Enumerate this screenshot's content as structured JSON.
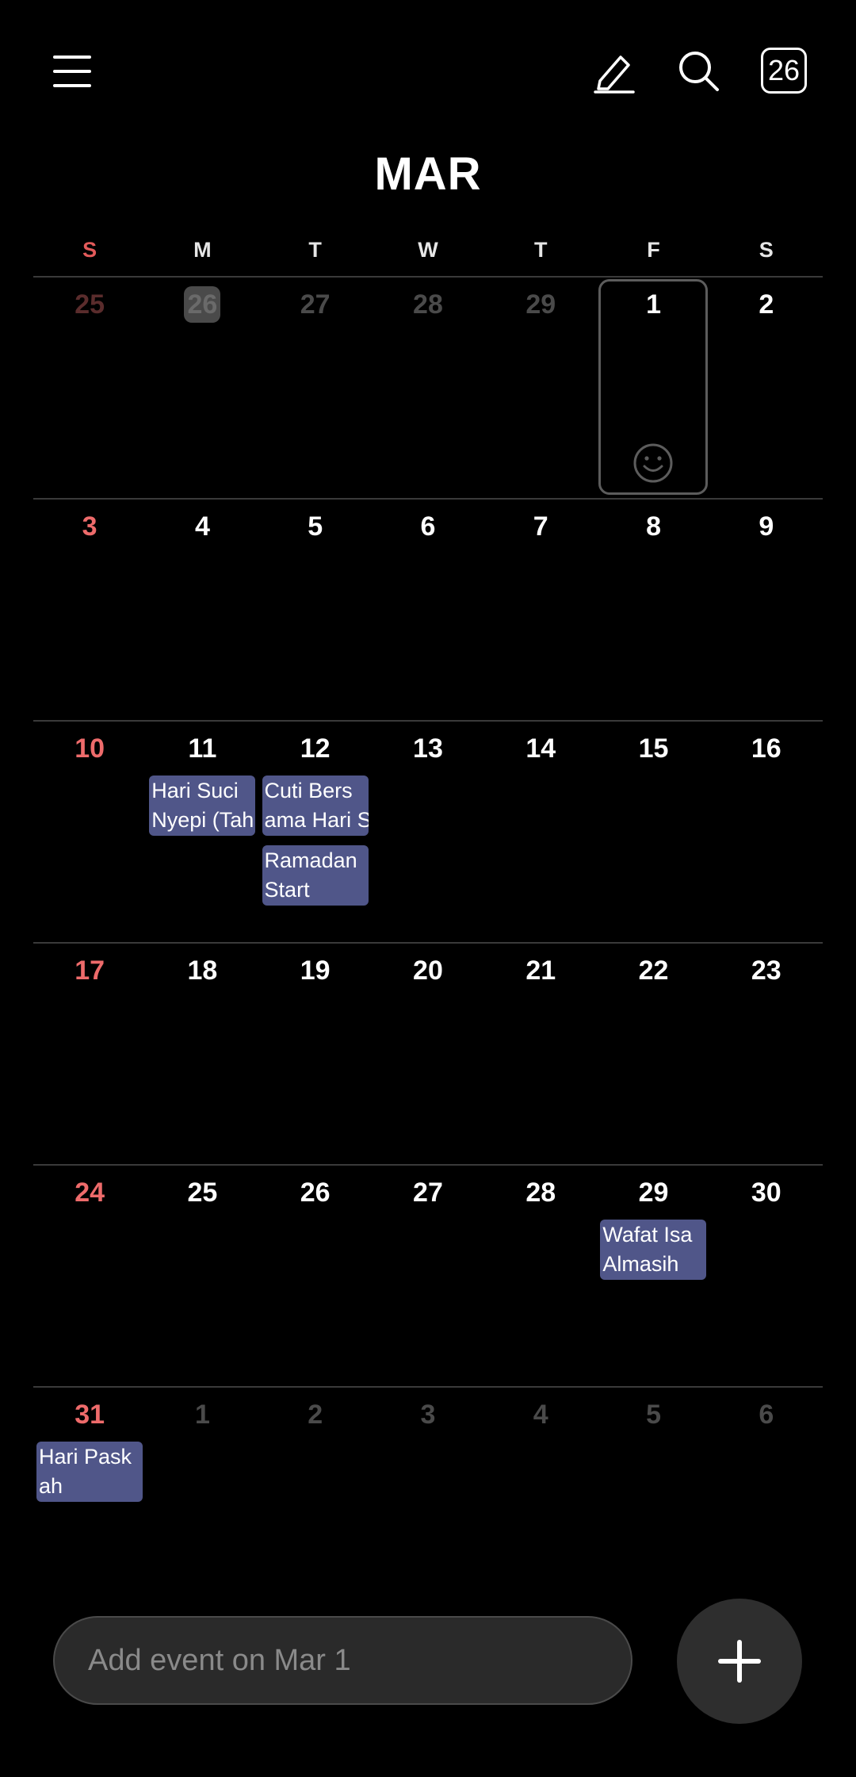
{
  "header": {
    "menu_icon": "hamburger-menu-icon",
    "edit_icon": "pencil-icon",
    "search_icon": "search-icon",
    "today_label": "26"
  },
  "month_title": "MAR",
  "weekdays": [
    "S",
    "M",
    "T",
    "W",
    "T",
    "F",
    "S"
  ],
  "weeks": [
    [
      {
        "d": "25",
        "dim": true
      },
      {
        "d": "26",
        "dim": true,
        "today": true
      },
      {
        "d": "27",
        "dim": true
      },
      {
        "d": "28",
        "dim": true
      },
      {
        "d": "29",
        "dim": true
      },
      {
        "d": "1",
        "selected": true
      },
      {
        "d": "2"
      }
    ],
    [
      {
        "d": "3"
      },
      {
        "d": "4"
      },
      {
        "d": "5"
      },
      {
        "d": "6"
      },
      {
        "d": "7"
      },
      {
        "d": "8"
      },
      {
        "d": "9"
      }
    ],
    [
      {
        "d": "10"
      },
      {
        "d": "11",
        "events": [
          "Hari Suci\nNyepi (Tah"
        ]
      },
      {
        "d": "12",
        "events": [
          "Cuti Bers\nama Hari S",
          "Ramadan\nStart"
        ]
      },
      {
        "d": "13"
      },
      {
        "d": "14"
      },
      {
        "d": "15"
      },
      {
        "d": "16"
      }
    ],
    [
      {
        "d": "17"
      },
      {
        "d": "18"
      },
      {
        "d": "19"
      },
      {
        "d": "20"
      },
      {
        "d": "21"
      },
      {
        "d": "22"
      },
      {
        "d": "23"
      }
    ],
    [
      {
        "d": "24"
      },
      {
        "d": "25"
      },
      {
        "d": "26"
      },
      {
        "d": "27"
      },
      {
        "d": "28"
      },
      {
        "d": "29",
        "events": [
          "Wafat Isa\nAlmasih"
        ]
      },
      {
        "d": "30"
      }
    ],
    [
      {
        "d": "31",
        "events": [
          "Hari Pask\nah"
        ]
      },
      {
        "d": "1",
        "dim": true
      },
      {
        "d": "2",
        "dim": true
      },
      {
        "d": "3",
        "dim": true
      },
      {
        "d": "4",
        "dim": true
      },
      {
        "d": "5",
        "dim": true
      },
      {
        "d": "6",
        "dim": true
      }
    ]
  ],
  "add_event": {
    "placeholder": "Add event on Mar 1"
  },
  "fab_icon": "plus-icon",
  "colors": {
    "sunday": "#ee6b6b",
    "event_bg": "#505689",
    "selected_border": "#5c5c5c"
  }
}
